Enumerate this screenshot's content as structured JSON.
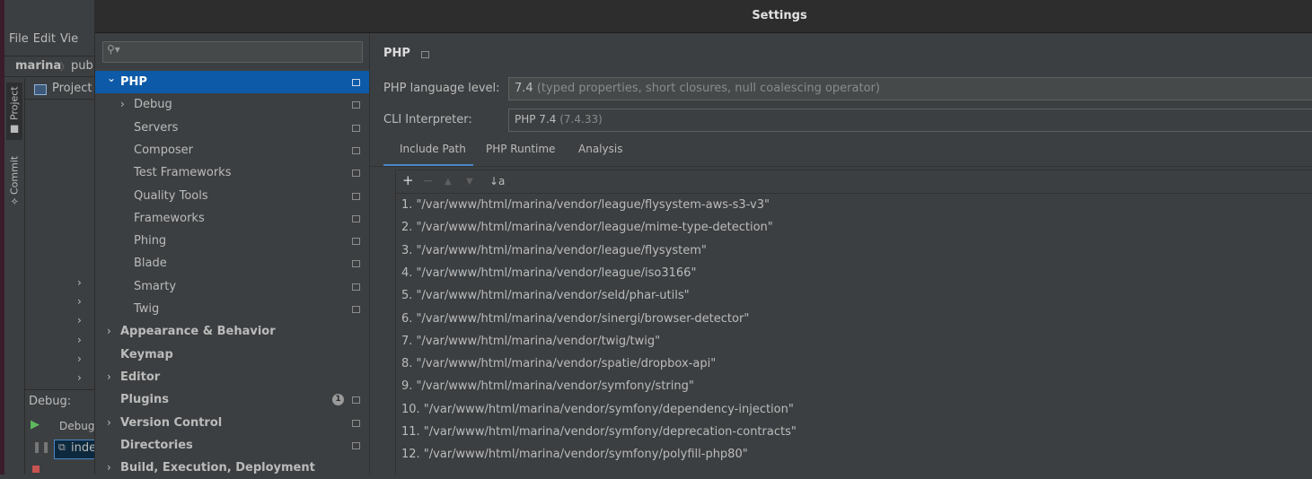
{
  "ide": {
    "menu": [
      "File",
      "Edit",
      "Vie"
    ],
    "nav": {
      "project": "marina",
      "crumb": "pub"
    },
    "side_tabs": {
      "project": "Project",
      "commit": "Commit"
    },
    "project_header": "Project",
    "debug_label": "Debug:",
    "debug_tab_label": "Debug",
    "debug_item": "inde"
  },
  "dialog": {
    "title": "Settings",
    "search": {
      "value": "",
      "placeholder": ""
    },
    "tree": [
      {
        "label": "PHP",
        "level": 0,
        "expanded": true,
        "selected": true
      },
      {
        "label": "Debug",
        "level": 1,
        "expandable": true
      },
      {
        "label": "Servers",
        "level": 1
      },
      {
        "label": "Composer",
        "level": 1
      },
      {
        "label": "Test Frameworks",
        "level": 1
      },
      {
        "label": "Quality Tools",
        "level": 1
      },
      {
        "label": "Frameworks",
        "level": 1
      },
      {
        "label": "Phing",
        "level": 1
      },
      {
        "label": "Blade",
        "level": 1
      },
      {
        "label": "Smarty",
        "level": 1
      },
      {
        "label": "Twig",
        "level": 1
      },
      {
        "label": "Appearance & Behavior",
        "level": 0,
        "expandable": true
      },
      {
        "label": "Keymap",
        "level": 0
      },
      {
        "label": "Editor",
        "level": 0,
        "expandable": true
      },
      {
        "label": "Plugins",
        "level": 0,
        "badge": "1"
      },
      {
        "label": "Version Control",
        "level": 0,
        "expandable": true
      },
      {
        "label": "Directories",
        "level": 0
      },
      {
        "label": "Build, Execution, Deployment",
        "level": 0,
        "expandable": true
      }
    ],
    "breadcrumb": "PHP",
    "language_level": {
      "label": "PHP language level:",
      "value": "7.4",
      "detail": "(typed properties, short closures, null coalescing operator)"
    },
    "cli": {
      "label": "CLI Interpreter:",
      "value": "PHP 7.4",
      "detail": "(7.4.33)"
    },
    "tabs": [
      {
        "label": "Include Path",
        "active": true
      },
      {
        "label": "PHP Runtime",
        "active": false
      },
      {
        "label": "Analysis",
        "active": false
      }
    ],
    "include_paths": [
      "1. \"/var/www/html/marina/vendor/league/flysystem-aws-s3-v3\"",
      "2. \"/var/www/html/marina/vendor/league/mime-type-detection\"",
      "3. \"/var/www/html/marina/vendor/league/flysystem\"",
      "4. \"/var/www/html/marina/vendor/league/iso3166\"",
      "5. \"/var/www/html/marina/vendor/seld/phar-utils\"",
      "6. \"/var/www/html/marina/vendor/sinergi/browser-detector\"",
      "7. \"/var/www/html/marina/vendor/twig/twig\"",
      "8. \"/var/www/html/marina/vendor/spatie/dropbox-api\"",
      "9. \"/var/www/html/marina/vendor/symfony/string\"",
      "10. \"/var/www/html/marina/vendor/symfony/dependency-injection\"",
      "11. \"/var/www/html/marina/vendor/symfony/deprecation-contracts\"",
      "12. \"/var/www/html/marina/vendor/symfony/polyfill-php80\""
    ]
  },
  "colors": {
    "selection": "#0d5aa8",
    "accent": "#4a88c7",
    "panel": "#3c3f41",
    "titlebar": "#2d2d2d"
  }
}
